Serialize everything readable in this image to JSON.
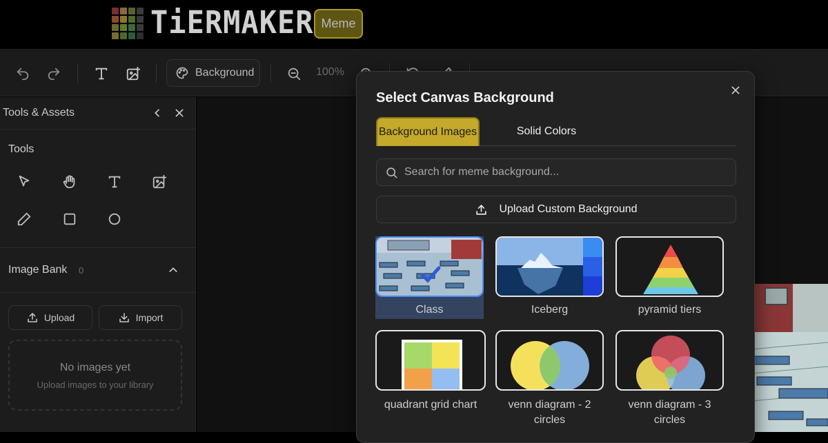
{
  "header": {
    "logo_text": "TiERMAKER",
    "badge": "Meme",
    "logo_colors": [
      "#7a2e2e",
      "#8a6a3a",
      "#5e5e2e",
      "#3a3a3a",
      "#8a4a2e",
      "#8a7a2e",
      "#4a6a2e",
      "#3a3a3a",
      "#6a6a2e",
      "#5e7a2e",
      "#3a6a3a",
      "#3a3a3a",
      "#7a6a2e",
      "#4a6a2e",
      "#2e5a3a",
      "#2e2e2e"
    ]
  },
  "toolbar": {
    "background_label": "Background",
    "zoom": "100%",
    "icons": [
      "undo-icon",
      "redo-icon",
      "text-icon",
      "add-image-icon",
      "palette-icon",
      "zoom-out-icon",
      "zoom-in-icon",
      "rotate-icon",
      "brush-icon"
    ]
  },
  "sidebar": {
    "title": "Tools & Assets",
    "tools_header": "Tools",
    "tools": [
      "pointer-icon",
      "hand-icon",
      "text-icon",
      "add-image-icon",
      "pencil-icon",
      "rectangle-icon",
      "circle-icon"
    ],
    "image_bank_header": "Image Bank",
    "image_bank_count": "0",
    "upload_label": "Upload",
    "import_label": "Import",
    "empty_title": "No images yet",
    "empty_subtitle": "Upload images to your library"
  },
  "modal": {
    "title": "Select Canvas Background",
    "tabs": [
      {
        "label": "Background Images",
        "active": true
      },
      {
        "label": "Solid Colors",
        "active": false
      }
    ],
    "search_placeholder": "Search for meme background...",
    "upload_label": "Upload Custom Background",
    "accent_color": "#c4a92a",
    "backgrounds": [
      {
        "label": "Class",
        "selected": true
      },
      {
        "label": "Iceberg",
        "selected": false
      },
      {
        "label": "pyramid tiers",
        "selected": false
      },
      {
        "label": "quadrant grid chart",
        "selected": false
      },
      {
        "label": "venn diagram - 2 circles",
        "selected": false
      },
      {
        "label": "venn diagram - 3 circles",
        "selected": false
      }
    ]
  }
}
